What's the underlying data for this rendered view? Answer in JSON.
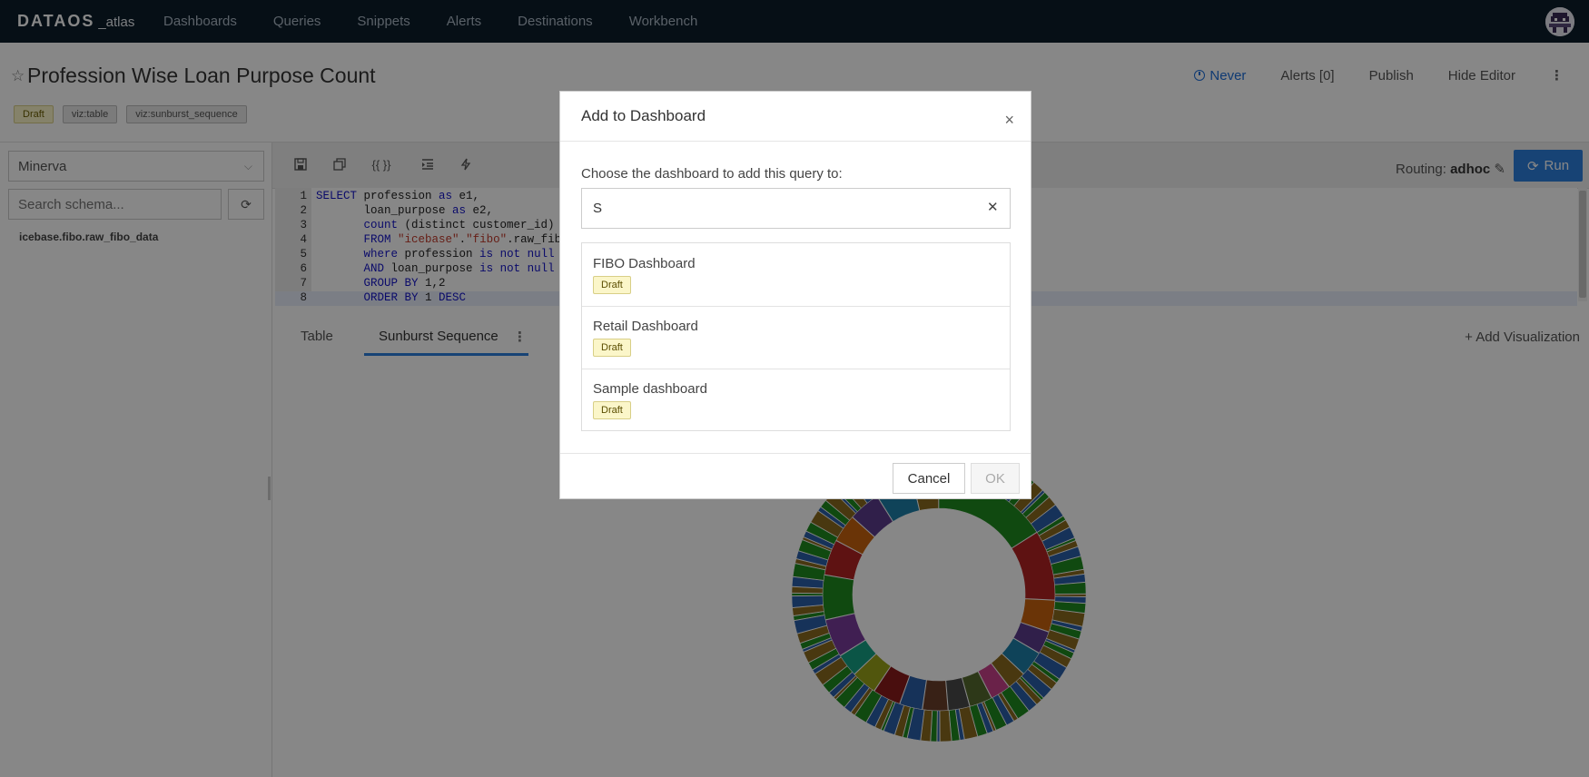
{
  "app": {
    "logo": "DataOS",
    "logo_sub": "_atlas"
  },
  "nav": {
    "items": [
      {
        "label": "Dashboards"
      },
      {
        "label": "Queries"
      },
      {
        "label": "Snippets"
      },
      {
        "label": "Alerts"
      },
      {
        "label": "Destinations"
      },
      {
        "label": "Workbench"
      }
    ]
  },
  "query": {
    "title": "Profession Wise Loan Purpose Count",
    "tags": [
      "Draft",
      "viz:table",
      "viz:sunburst_sequence"
    ],
    "refresh_schedule": "Never",
    "alerts_label": "Alerts [0]",
    "publish_label": "Publish",
    "hide_editor_label": "Hide Editor",
    "more_label": "⋮"
  },
  "schema": {
    "data_source": "Minerva",
    "search_placeholder": "Search schema...",
    "tables": [
      "icebase.fibo.raw_fibo_data"
    ]
  },
  "editor": {
    "routing_label": "Routing:",
    "routing_value": "adhoc",
    "run_label": "Run",
    "lines": [
      {
        "num": "1",
        "text": "SELECT profession as e1,"
      },
      {
        "num": "2",
        "text": "       loan_purpose as e2,"
      },
      {
        "num": "3",
        "text": "       count (distinct customer_id) c"
      },
      {
        "num": "4",
        "text": "       FROM \"icebase\".\"fibo\".raw_fibo"
      },
      {
        "num": "5",
        "text": "       where profession is not null"
      },
      {
        "num": "6",
        "text": "       AND loan_purpose is not null"
      },
      {
        "num": "7",
        "text": "       GROUP BY 1,2"
      },
      {
        "num": "8",
        "text": "       ORDER BY 1 DESC"
      }
    ]
  },
  "viz": {
    "tabs": [
      {
        "label": "Table"
      },
      {
        "label": "Sunburst Sequence"
      }
    ],
    "active_tab": "Sunburst Sequence",
    "add_label": "+ Add Visualization"
  },
  "modal": {
    "title": "Add to Dashboard",
    "close_label": "×",
    "prompt": "Choose the dashboard to add this query to:",
    "search_value": "S",
    "dashboards": [
      {
        "name": "FIBO Dashboard",
        "status": "Draft"
      },
      {
        "name": "Retail Dashboard",
        "status": "Draft"
      },
      {
        "name": "Sample dashboard",
        "status": "Draft"
      }
    ],
    "cancel_label": "Cancel",
    "ok_label": "OK"
  },
  "colors": {
    "navbar_bg": "#0c1d2b",
    "accent": "#2d7fde",
    "draft_badge_bg": "#fbf6c9"
  }
}
